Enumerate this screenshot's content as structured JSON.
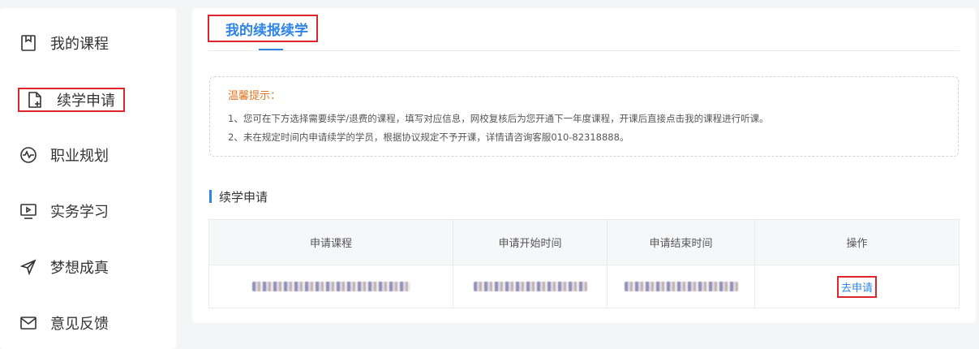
{
  "sidebar": {
    "items": [
      {
        "label": "我的课程",
        "icon": "bookmark-icon"
      },
      {
        "label": "续学申请",
        "icon": "file-add-icon",
        "active": true
      },
      {
        "label": "职业规划",
        "icon": "pulse-icon"
      },
      {
        "label": "实务学习",
        "icon": "monitor-icon"
      },
      {
        "label": "梦想成真",
        "icon": "send-icon"
      },
      {
        "label": "意见反馈",
        "icon": "mail-icon"
      }
    ]
  },
  "main": {
    "tab_title": "我的续报续学",
    "notice": {
      "title": "温馨提示：",
      "lines": [
        "1、您可在下方选择需要续学/退费的课程，填写对应信息，网校复核后为您开通下一年度课程，开课后直接点击我的课程进行听课。",
        "2、未在规定时间内申请续学的学员，根据协议规定不予开课，详情请咨询客服010-82318888。"
      ]
    },
    "section_title": "续学申请",
    "table": {
      "headers": [
        "申请课程",
        "申请开始时间",
        "申请结束时间",
        "操作"
      ],
      "action_label": "去申请"
    }
  },
  "colors": {
    "accent": "#2f84e8",
    "highlight_border": "#e0242b",
    "notice_title": "#e27622"
  }
}
